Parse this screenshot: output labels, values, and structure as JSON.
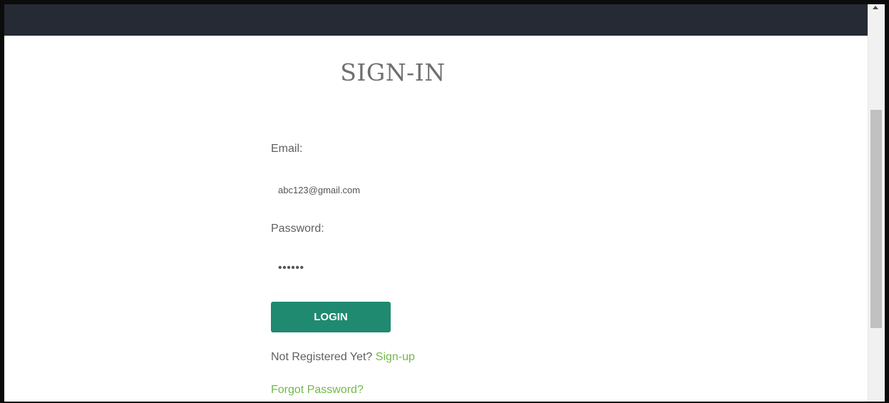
{
  "page": {
    "title": "SIGN-IN"
  },
  "form": {
    "email_label": "Email:",
    "email_value": "abc123@gmail.com",
    "password_label": "Password:",
    "password_value": "••••••",
    "login_label": "LOGIN",
    "not_registered_text": "Not Registered Yet?",
    "signup_link": "Sign-up",
    "forgot_link": "Forgot Password?"
  },
  "colors": {
    "navbar": "#252a34",
    "button": "#1f8a70",
    "link": "#74b84a"
  },
  "icons": {
    "scroll_up": "scroll-up-arrow-icon"
  }
}
